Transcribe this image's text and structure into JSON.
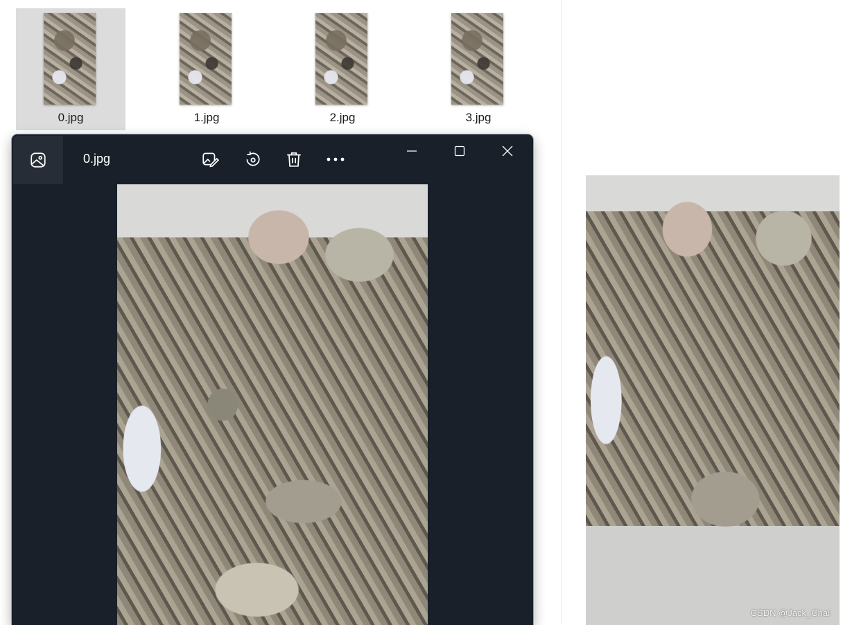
{
  "explorer": {
    "files": [
      {
        "name": "0.jpg"
      },
      {
        "name": "1.jpg"
      },
      {
        "name": "2.jpg"
      },
      {
        "name": "3.jpg"
      }
    ]
  },
  "viewer": {
    "title": "0.jpg",
    "toolbar": {
      "edit_icon": "edit-image-icon",
      "rotate_icon": "rotate-icon",
      "delete_icon": "delete-icon",
      "more_icon": "more-icon"
    },
    "window_controls": [
      "minimize-icon",
      "maximize-icon",
      "close-icon"
    ]
  },
  "watermark": "CSDN @Jack_Chai",
  "colors": {
    "viewer_background": "#19202a",
    "selected_tile": "#dcdcdc"
  }
}
